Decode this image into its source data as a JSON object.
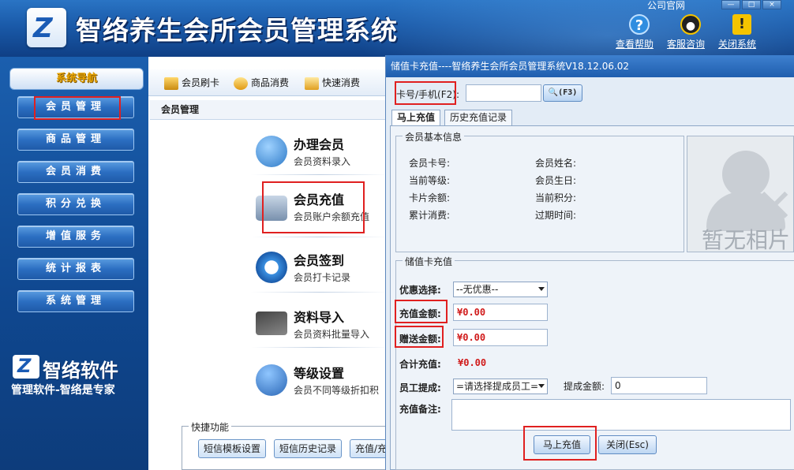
{
  "header": {
    "title": "智络养生会所会员管理系统",
    "official_site": "公司官网",
    "buttons": {
      "help": "查看帮助",
      "support": "客服咨询",
      "close": "关闭系统"
    }
  },
  "sidebar": {
    "nav_title": "系统导航",
    "items": [
      "会员管理",
      "商品管理",
      "会员消费",
      "积分兑换",
      "增值服务",
      "统计报表",
      "系统管理"
    ],
    "brand_name": "智络软件",
    "brand_slogan": "管理软件-智络是专家"
  },
  "toolbar": {
    "items": [
      "会员刷卡",
      "商品消费",
      "快速消费"
    ]
  },
  "main": {
    "breadcrumb": "会员管理",
    "functions": [
      {
        "title": "办理会员",
        "subtitle": "会员资料录入"
      },
      {
        "title": "会员充值",
        "subtitle": "会员账户余额充值"
      },
      {
        "title": "会员签到",
        "subtitle": "会员打卡记录"
      },
      {
        "title": "资料导入",
        "subtitle": "会员资料批量导入"
      },
      {
        "title": "等级设置",
        "subtitle": "会员不同等级折扣积"
      }
    ],
    "quick": {
      "legend": "快捷功能",
      "buttons": [
        "短信模板设置",
        "短信历史记录",
        "充值/充"
      ]
    }
  },
  "dialog": {
    "title": "储值卡充值----智络养生会所会员管理系统V18.12.06.02",
    "card_label": "卡号/手机(F2):",
    "card_value": "",
    "search_button": "(F3)",
    "tabs": [
      "马上充值",
      "历史充值记录"
    ],
    "info_group": {
      "legend": "会员基本信息",
      "left_fields": [
        "会员卡号:",
        "当前等级:",
        "卡片余额:",
        "累计消费:"
      ],
      "right_fields": [
        "会员姓名:",
        "会员生日:",
        "当前积分:",
        "过期时间:"
      ]
    },
    "photo_placeholder": "暂无相片",
    "recharge_group": {
      "legend": "储值卡充值",
      "discount_label": "优惠选择:",
      "discount_value": "--无优惠--",
      "amount_label": "充值金额:",
      "amount_value": "¥0.00",
      "gift_label": "赠送金额:",
      "gift_value": "¥0.00",
      "total_label": "合计充值:",
      "total_value": "¥0.00",
      "staff_label": "员工提成:",
      "staff_value": "=请选择提成员工=",
      "commission_label": "提成金额:",
      "commission_value": "0",
      "remark_label": "充值备注:",
      "remark_value": ""
    },
    "buttons": {
      "recharge": "马上充值",
      "close": "关闭(Esc)"
    }
  }
}
